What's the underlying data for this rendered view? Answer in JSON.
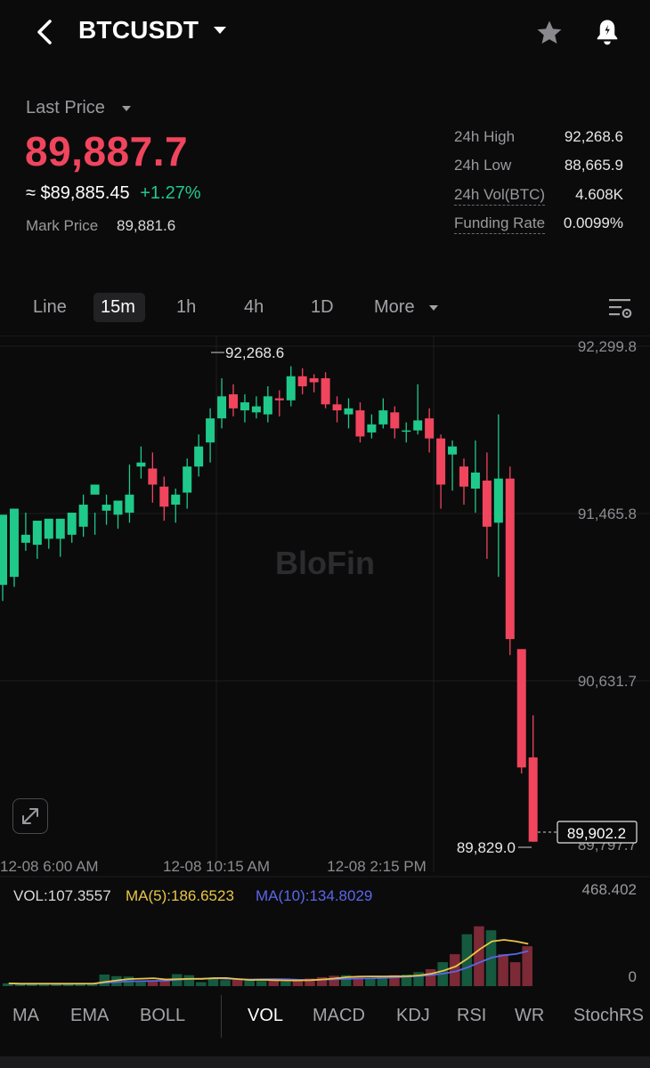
{
  "header": {
    "pair": "BTCUSDT"
  },
  "ticker": {
    "last_price_label": "Last Price",
    "last_price": "89,887.7",
    "usd_value": "≈ $89,885.45",
    "change_pct": "+1.27%",
    "mark_price_label": "Mark Price",
    "mark_price": "89,881.6",
    "stats": {
      "high_label": "24h High",
      "high": "92,268.6",
      "low_label": "24h Low",
      "low": "88,665.9",
      "vol_label": "24h Vol(BTC)",
      "vol": "4.608K",
      "funding_label": "Funding Rate",
      "funding": "0.0099%"
    }
  },
  "timeframes": [
    "Line",
    "15m",
    "1h",
    "4h",
    "1D",
    "More"
  ],
  "active_timeframe": "15m",
  "colors": {
    "up": "#1fc98a",
    "down": "#f0455d",
    "ma5": "#e9c547",
    "ma10": "#5b66e8",
    "bg": "#0b0b0c"
  },
  "chart_data": {
    "type": "candlestick",
    "watermark": "BloFin",
    "y_ticks": [
      "92,299.8",
      "91,465.8",
      "90,631.7",
      "89,797.7"
    ],
    "y_tick_values": [
      92299.8,
      91465.8,
      90631.7,
      89797.7
    ],
    "x_ticks": [
      "12-08 6:00 AM",
      "12-08 10:15 AM",
      "12-08 2:15 PM"
    ],
    "high_annotation": "92,268.6",
    "low_annotation": "89,829.0",
    "last_price_tag": "89,902.2",
    "candles": [
      [
        91110,
        91460,
        91200,
        91030
      ],
      [
        91150,
        91490,
        91250,
        91100
      ],
      [
        91320,
        91360,
        91470,
        91280
      ],
      [
        91310,
        91430,
        91380,
        91240
      ],
      [
        91340,
        91440,
        91410,
        91290
      ],
      [
        91340,
        91440,
        91390,
        91250
      ],
      [
        91360,
        91470,
        91400,
        91320
      ],
      [
        91400,
        91510,
        91560,
        91350
      ],
      [
        91560,
        91610,
        91470,
        91360
      ],
      [
        91480,
        91510,
        91560,
        91410
      ],
      [
        91460,
        91530,
        91490,
        91390
      ],
      [
        91470,
        91560,
        91710,
        91420
      ],
      [
        91700,
        91720,
        91800,
        91640
      ],
      [
        91690,
        91610,
        91770,
        91520
      ],
      [
        91600,
        91500,
        91650,
        91430
      ],
      [
        91510,
        91560,
        91590,
        91420
      ],
      [
        91570,
        91700,
        91740,
        91490
      ],
      [
        91700,
        91800,
        91860,
        91650
      ],
      [
        91820,
        91940,
        91990,
        91720
      ],
      [
        91940,
        92050,
        92140,
        91890
      ],
      [
        92060,
        91990,
        92110,
        91950
      ],
      [
        91980,
        92020,
        92060,
        91920
      ],
      [
        91970,
        92000,
        92050,
        91940
      ],
      [
        91960,
        92050,
        92100,
        91920
      ],
      [
        92040,
        92030,
        92080,
        91950
      ],
      [
        92030,
        92150,
        92200,
        92000
      ],
      [
        92150,
        92100,
        92190,
        92060
      ],
      [
        92140,
        92120,
        92160,
        92070
      ],
      [
        92140,
        92010,
        92170,
        91990
      ],
      [
        92010,
        91980,
        92050,
        91920
      ],
      [
        91960,
        91990,
        92040,
        91890
      ],
      [
        91980,
        91850,
        92020,
        91820
      ],
      [
        91870,
        91910,
        91960,
        91840
      ],
      [
        91910,
        91980,
        92040,
        91890
      ],
      [
        91970,
        91890,
        92000,
        91840
      ],
      [
        91880,
        91880,
        91920,
        91820
      ],
      [
        91880,
        91930,
        92110,
        91860
      ],
      [
        91940,
        91840,
        91990,
        91770
      ],
      [
        91840,
        91610,
        91860,
        91490
      ],
      [
        91760,
        91800,
        91830,
        91580
      ],
      [
        91700,
        91600,
        91740,
        91510
      ],
      [
        91590,
        91670,
        91830,
        91470
      ],
      [
        91630,
        91400,
        91770,
        91240
      ],
      [
        91420,
        91640,
        91960,
        91150
      ],
      [
        91640,
        90840,
        91700,
        90760
      ],
      [
        90790,
        90200,
        90790,
        90170
      ],
      [
        90250,
        89830,
        90460,
        89829
      ]
    ],
    "volume": {
      "values": [
        14,
        10,
        12,
        13,
        11,
        14,
        12,
        11,
        58,
        50,
        48,
        20,
        22,
        26,
        60,
        55,
        20,
        38,
        30,
        33,
        32,
        26,
        28,
        22,
        35,
        38,
        45,
        52,
        55,
        50,
        40,
        45,
        55,
        58,
        70,
        85,
        120,
        160,
        260,
        300,
        280,
        160,
        120,
        200
      ],
      "max_label": "468.402",
      "zero_label": "0",
      "vol_label": "VOL:107.3557",
      "ma5_label": "MA(5):186.6523",
      "ma10_label": "MA(10):134.8029"
    }
  },
  "indicators_main": [
    "MA",
    "EMA",
    "BOLL"
  ],
  "indicators_sub": [
    "VOL",
    "MACD",
    "KDJ",
    "RSI",
    "WR",
    "StochRS"
  ],
  "active_indicator": "VOL"
}
